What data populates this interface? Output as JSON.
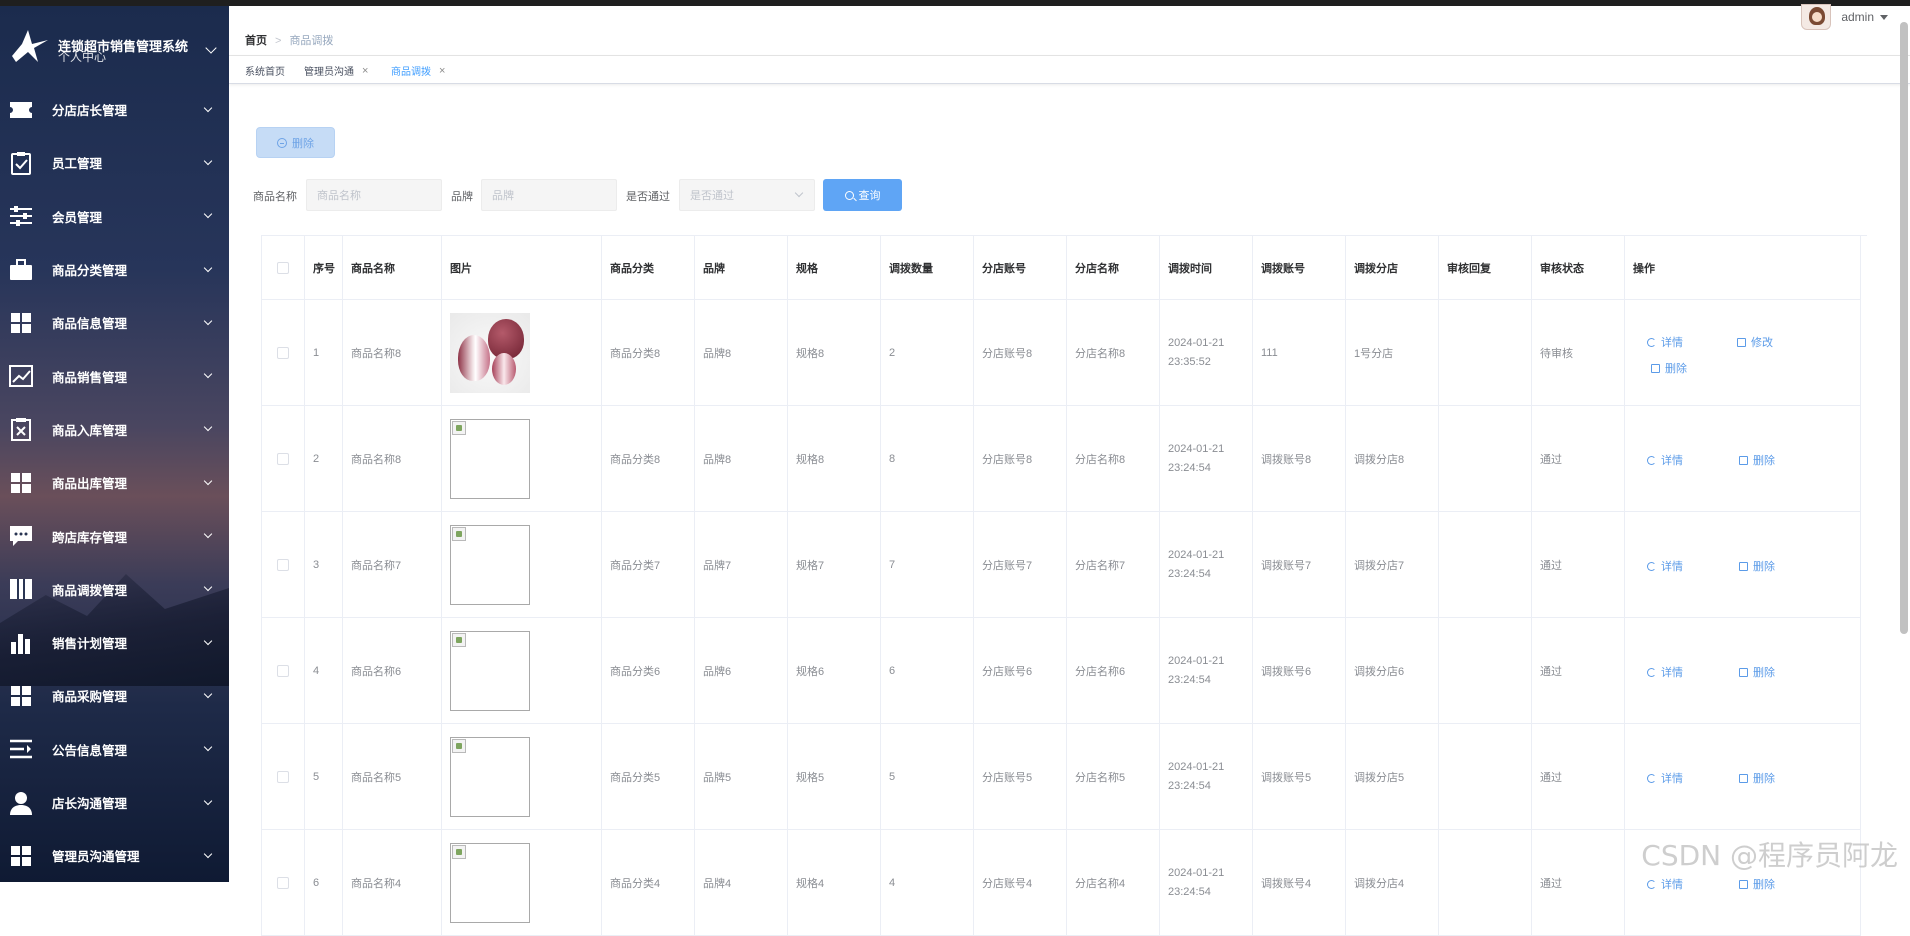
{
  "sidebar": {
    "brand_title": "连锁超市销售管理系统",
    "brand_sub": "个人中心",
    "items": [
      {
        "label": "分店店长管理",
        "icon": "ticket-icon"
      },
      {
        "label": "员工管理",
        "icon": "clipboard-check-icon"
      },
      {
        "label": "会员管理",
        "icon": "sliders-icon"
      },
      {
        "label": "商品分类管理",
        "icon": "briefcase-icon"
      },
      {
        "label": "商品信息管理",
        "icon": "grid-icon"
      },
      {
        "label": "商品销售管理",
        "icon": "line-chart-icon"
      },
      {
        "label": "商品入库管理",
        "icon": "delete-box-icon"
      },
      {
        "label": "商品出库管理",
        "icon": "grid-icon"
      },
      {
        "label": "跨店库存管理",
        "icon": "chat-icon"
      },
      {
        "label": "商品调拨管理",
        "icon": "book-icon"
      },
      {
        "label": "销售计划管理",
        "icon": "bar-chart-icon"
      },
      {
        "label": "商品采购管理",
        "icon": "grid-icon"
      },
      {
        "label": "公告信息管理",
        "icon": "list-indent-icon"
      },
      {
        "label": "店长沟通管理",
        "icon": "user-icon"
      },
      {
        "label": "管理员沟通管理",
        "icon": "grid-icon"
      }
    ]
  },
  "header": {
    "breadcrumb_home": "首页",
    "breadcrumb_sep": ">",
    "breadcrumb_current": "商品调拨",
    "user_name": "admin"
  },
  "tags": [
    {
      "label": "系统首页",
      "closable": false
    },
    {
      "label": "管理员沟通",
      "closable": true
    },
    {
      "label": "商品调拨",
      "closable": true,
      "active": true
    }
  ],
  "tag_close": "×",
  "toolbar": {
    "delete_label": "删除"
  },
  "search": {
    "name_label": "商品名称",
    "name_placeholder": "商品名称",
    "brand_label": "品牌",
    "brand_placeholder": "品牌",
    "pass_label": "是否通过",
    "pass_placeholder": "是否通过",
    "query_label": "查询"
  },
  "table": {
    "headers": [
      "序号",
      "商品名称",
      "图片",
      "商品分类",
      "品牌",
      "规格",
      "调拨数量",
      "分店账号",
      "分店名称",
      "调拨时间",
      "调拨账号",
      "调拨分店",
      "审核回复",
      "审核状态",
      "操作"
    ],
    "rows": [
      {
        "no": "1",
        "name": "商品名称8",
        "cat": "商品分类8",
        "brand": "品牌8",
        "spec": "规格8",
        "qty": "2",
        "acct": "分店账号8",
        "shop": "分店名称8",
        "time": "2024-01-21 23:35:52",
        "tacct": "111",
        "tshop": "1号分店",
        "reply": "",
        "status": "待审核"
      },
      {
        "no": "2",
        "name": "商品名称8",
        "cat": "商品分类8",
        "brand": "品牌8",
        "spec": "规格8",
        "qty": "8",
        "acct": "分店账号8",
        "shop": "分店名称8",
        "time": "2024-01-21 23:24:54",
        "tacct": "调拨账号8",
        "tshop": "调拨分店8",
        "reply": "",
        "status": "通过"
      },
      {
        "no": "3",
        "name": "商品名称7",
        "cat": "商品分类7",
        "brand": "品牌7",
        "spec": "规格7",
        "qty": "7",
        "acct": "分店账号7",
        "shop": "分店名称7",
        "time": "2024-01-21 23:24:54",
        "tacct": "调拨账号7",
        "tshop": "调拨分店7",
        "reply": "",
        "status": "通过"
      },
      {
        "no": "4",
        "name": "商品名称6",
        "cat": "商品分类6",
        "brand": "品牌6",
        "spec": "规格6",
        "qty": "6",
        "acct": "分店账号6",
        "shop": "分店名称6",
        "time": "2024-01-21 23:24:54",
        "tacct": "调拨账号6",
        "tshop": "调拨分店6",
        "reply": "",
        "status": "通过"
      },
      {
        "no": "5",
        "name": "商品名称5",
        "cat": "商品分类5",
        "brand": "品牌5",
        "spec": "规格5",
        "qty": "5",
        "acct": "分店账号5",
        "shop": "分店名称5",
        "time": "2024-01-21 23:24:54",
        "tacct": "调拨账号5",
        "tshop": "调拨分店5",
        "reply": "",
        "status": "通过"
      },
      {
        "no": "6",
        "name": "商品名称4",
        "cat": "商品分类4",
        "brand": "品牌4",
        "spec": "规格4",
        "qty": "4",
        "acct": "分店账号4",
        "shop": "分店名称4",
        "time": "2024-01-21 23:24:54",
        "tacct": "调拨账号4",
        "tshop": "调拨分店4",
        "reply": "",
        "status": "通过"
      }
    ],
    "op_detail": "详情",
    "op_edit": "修改",
    "op_delete": "删除"
  },
  "watermark": "CSDN @程序员阿龙"
}
